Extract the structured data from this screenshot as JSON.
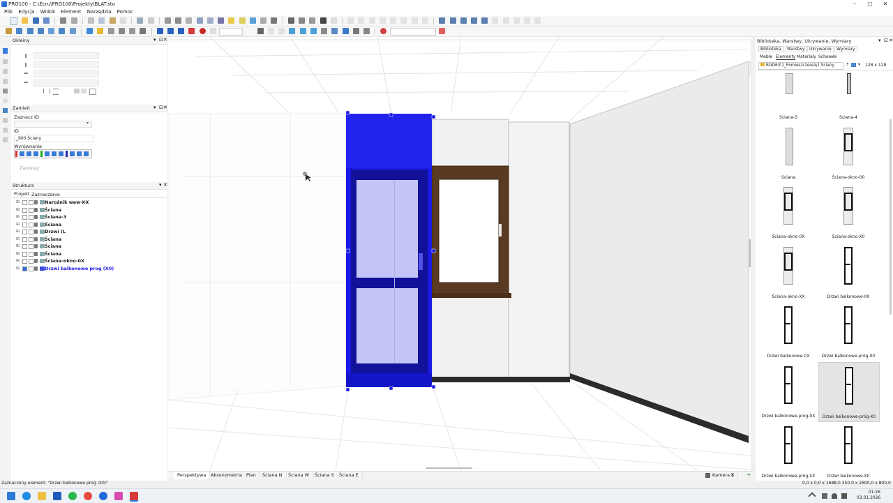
{
  "window": {
    "title": "PRO100 - C:\\Ecru\\PRO100\\Projekty\\BLAT.sto",
    "minimize": "–",
    "maximize": "▢",
    "close": "✕"
  },
  "menu": [
    "Plik",
    "Edycja",
    "Widok",
    "Element",
    "Narzędzia",
    "Pomoc"
  ],
  "panels": {
    "okleiny": {
      "title": "Okleiny"
    },
    "zamien": {
      "title": "Zamień",
      "zaznacz_id_label": "Zaznacz ID",
      "id_label": "ID",
      "id_value": "_900 Ściany",
      "wyrownanie_label": "Wyrównanie",
      "apply_button": "Zastosuj"
    },
    "struktura": {
      "title": "Struktura",
      "tabs": [
        "Projekt",
        "Zaznaczenie"
      ],
      "items": [
        {
          "label": "Narożnik wew-XX",
          "selected": false
        },
        {
          "label": "Ściana",
          "selected": false
        },
        {
          "label": "Ściana-3",
          "selected": false
        },
        {
          "label": "Ściana",
          "selected": false
        },
        {
          "label": "Drzwi (L",
          "selected": false
        },
        {
          "label": "Ściana",
          "selected": false
        },
        {
          "label": "Ściana",
          "selected": false
        },
        {
          "label": "Ściana",
          "selected": false
        },
        {
          "label": "Ściana-okno-0X",
          "selected": false
        },
        {
          "label": "Drzwi balkonowe prog (X0)",
          "selected": true
        }
      ]
    }
  },
  "viewport": {
    "tabs": [
      "Perspektywa",
      "Aksonometria",
      "Plan",
      "Ściana N",
      "Ściana W",
      "Ściana S",
      "Ściana E"
    ],
    "active_tab": "Perspektywa",
    "camera_tab": "Kamera 1",
    "camera_close": "✕",
    "add_tab": "+"
  },
  "library": {
    "title": "Biblioteka, Warstwy, Ukrywanie, Wymiary",
    "tabs": [
      "Biblioteka",
      "Warstwy",
      "Ukrywanie",
      "Wymiary"
    ],
    "subtabs": [
      "Meble",
      "Elementy",
      "Materiały",
      "Schowek"
    ],
    "path": "RGD63\\1_Pomieszczenia\\1 Ściany",
    "size": "128 x 128",
    "items": [
      {
        "label": "Sciana-3",
        "kind": "wall",
        "selected": false
      },
      {
        "label": "Sciana-4",
        "kind": "wall-thin",
        "selected": false
      },
      {
        "label": "Sciana",
        "kind": "wall",
        "selected": false
      },
      {
        "label": "Ściana-okno-00",
        "kind": "window",
        "selected": false
      },
      {
        "label": "Ściana-okno-0X",
        "kind": "window",
        "selected": false
      },
      {
        "label": "Ściana-okno-X0",
        "kind": "window",
        "selected": false
      },
      {
        "label": "Ściana-okno-XX",
        "kind": "window",
        "selected": false
      },
      {
        "label": "Drzwi balkonowe-00",
        "kind": "door",
        "selected": false
      },
      {
        "label": "Drzwi balkonowe-0X",
        "kind": "door",
        "selected": false
      },
      {
        "label": "Drzwi balkonowe-próg-00",
        "kind": "door",
        "selected": false
      },
      {
        "label": "Drzwi balkonowe-próg-0X",
        "kind": "door",
        "selected": false
      },
      {
        "label": "Drzwi balkonowe-próg-X0",
        "kind": "door",
        "selected": true
      },
      {
        "label": "Drzwi balkonowe-próg-XX",
        "kind": "door",
        "selected": false
      },
      {
        "label": "Drzwi balkonowe-X0",
        "kind": "door",
        "selected": false
      }
    ]
  },
  "status": {
    "left": "Zaznaczony element: \"Drzwi balkonowe prog (X0)\"",
    "right": "0,0 x 0,0 x 1688,0     250,0 x 2600,0 x 800,0"
  },
  "taskbar": {
    "time": "01:26",
    "date": "03.01.2026"
  },
  "colors": {
    "selection": "#1a1ae6",
    "wood": "#5a3a22"
  }
}
